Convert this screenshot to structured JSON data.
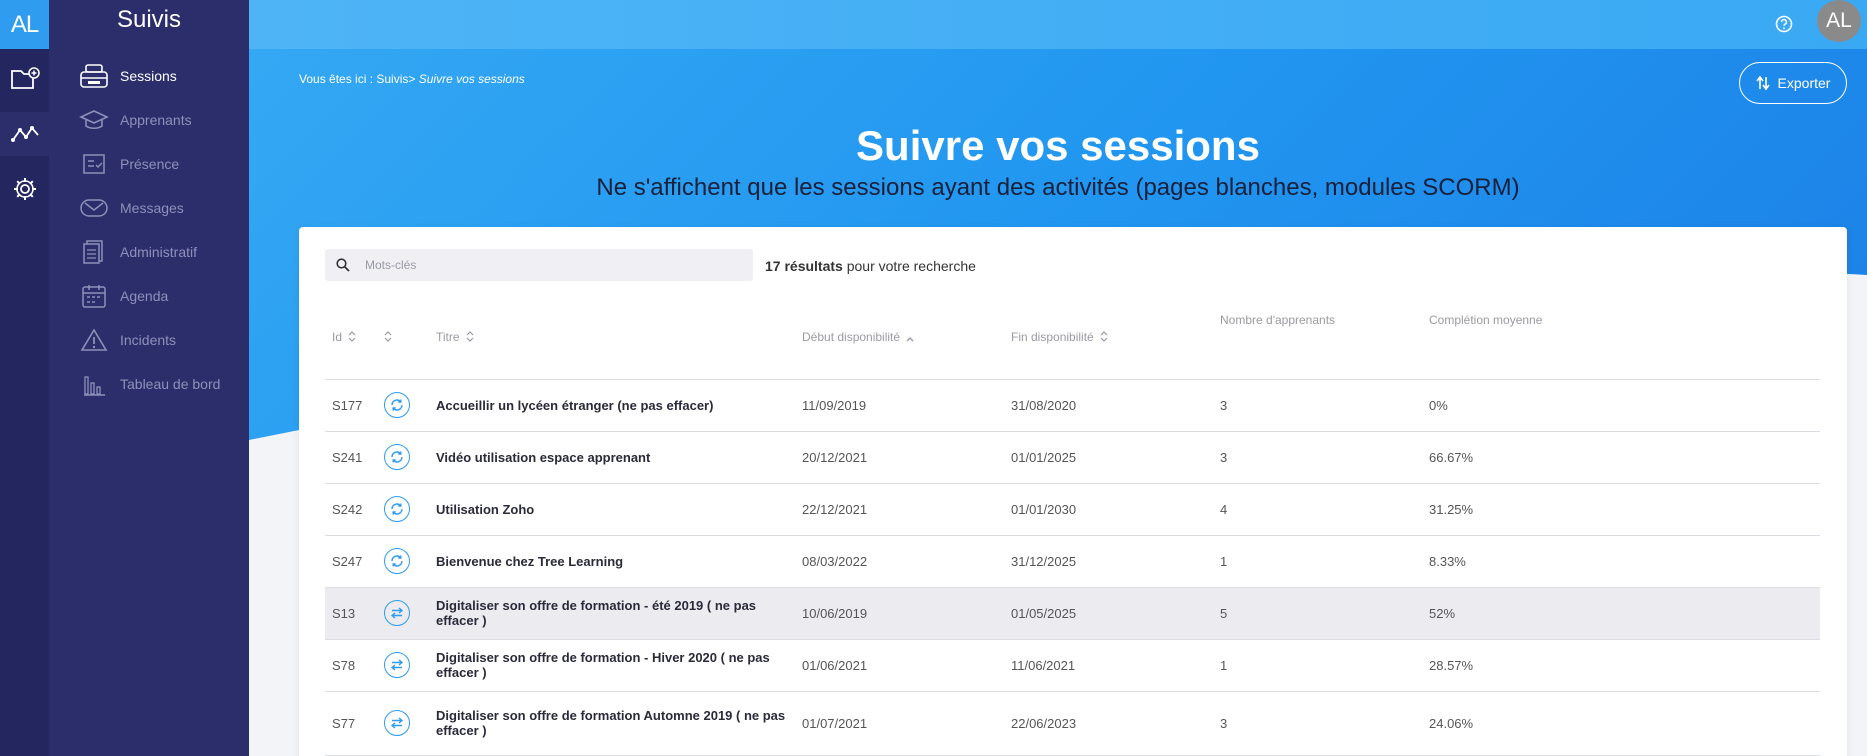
{
  "rail": {
    "logo": "AL",
    "icons": [
      "folder-add-icon",
      "analytics-icon",
      "gear-icon"
    ]
  },
  "sidebar": {
    "title": "Suivis",
    "items": [
      {
        "label": "Sessions",
        "icon": "sessions-icon",
        "active": true
      },
      {
        "label": "Apprenants",
        "icon": "graduation-cap-icon",
        "active": false
      },
      {
        "label": "Présence",
        "icon": "attendance-icon",
        "active": false
      },
      {
        "label": "Messages",
        "icon": "envelope-icon",
        "active": false
      },
      {
        "label": "Administratif",
        "icon": "documents-icon",
        "active": false
      },
      {
        "label": "Agenda",
        "icon": "calendar-icon",
        "active": false
      },
      {
        "label": "Incidents",
        "icon": "warning-icon",
        "active": false
      },
      {
        "label": "Tableau de bord",
        "icon": "bar-chart-icon",
        "active": false
      }
    ]
  },
  "topbar": {
    "help_icon": "help-icon",
    "avatar": "AL"
  },
  "breadcrumb": {
    "prefix": "Vous êtes ici : Suivis>",
    "current": "Suivre vos sessions"
  },
  "export_label": "Exporter",
  "page": {
    "title": "Suivre vos sessions",
    "subtitle": "Ne s'affichent que les sessions ayant des activités (pages blanches, modules SCORM)"
  },
  "search": {
    "placeholder": "Mots-clés",
    "value": ""
  },
  "results": {
    "count": "17 résultats",
    "suffix": "pour votre recherche"
  },
  "table": {
    "headers": {
      "id": "Id",
      "type": "",
      "titre": "Titre",
      "debut": "Début disponibilité",
      "fin": "Fin disponibilité",
      "nombre": "Nombre d'apprenants",
      "completion": "Complétion moyenne"
    },
    "rows": [
      {
        "id": "S177",
        "type": "cycle",
        "titre": "Accueillir un lycéen étranger (ne pas effacer)",
        "debut": "11/09/2019",
        "fin": "31/08/2020",
        "nombre": "3",
        "completion": "0%"
      },
      {
        "id": "S241",
        "type": "cycle",
        "titre": "Vidéo utilisation espace apprenant",
        "debut": "20/12/2021",
        "fin": "01/01/2025",
        "nombre": "3",
        "completion": "66.67%"
      },
      {
        "id": "S242",
        "type": "cycle",
        "titre": "Utilisation Zoho",
        "debut": "22/12/2021",
        "fin": "01/01/2030",
        "nombre": "4",
        "completion": "31.25%"
      },
      {
        "id": "S247",
        "type": "cycle",
        "titre": "Bienvenue chez Tree Learning",
        "debut": "08/03/2022",
        "fin": "31/12/2025",
        "nombre": "1",
        "completion": "8.33%"
      },
      {
        "id": "S13",
        "type": "swap",
        "titre": "Digitaliser son offre de formation - été 2019 ( ne pas effacer )",
        "debut": "10/06/2019",
        "fin": "01/05/2025",
        "nombre": "5",
        "completion": "52%"
      },
      {
        "id": "S78",
        "type": "swap",
        "titre": "Digitaliser son offre de formation - Hiver 2020 ( ne pas effacer )",
        "debut": "01/06/2021",
        "fin": "11/06/2021",
        "nombre": "1",
        "completion": "28.57%"
      },
      {
        "id": "S77",
        "type": "swap",
        "titre": "Digitaliser son offre de formation Automne 2019 ( ne pas effacer )",
        "debut": "01/07/2021",
        "fin": "22/06/2023",
        "nombre": "3",
        "completion": "24.06%"
      }
    ]
  },
  "colors": {
    "accent": "#2f9cf0",
    "rail_bg": "#23265f",
    "sidebar_bg": "#2b2e6b"
  }
}
